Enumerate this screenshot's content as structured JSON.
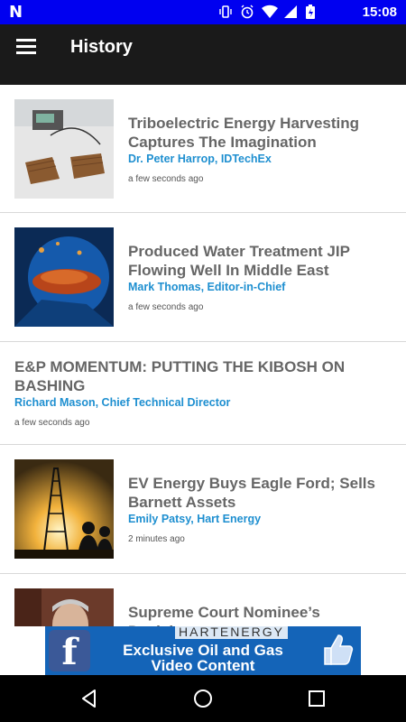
{
  "status_bar": {
    "time": "15:08",
    "left_icon": "N"
  },
  "app_bar": {
    "title": "History"
  },
  "articles": [
    {
      "title": "Triboelectric Energy Harvesting Captures The Imagination",
      "author": "Dr. Peter Harrop, IDTechEx",
      "time": "a few seconds ago",
      "has_thumb": true
    },
    {
      "title": "Produced Water Treatment JIP Flowing Well In Middle East",
      "author": "Mark Thomas, Editor-in-Chief",
      "time": "a few seconds ago",
      "has_thumb": true
    },
    {
      "title": "E&P MOMENTUM: PUTTING THE KIBOSH ON BASHING",
      "author": "Richard Mason, Chief Technical Director",
      "time": "a few seconds ago",
      "has_thumb": false
    },
    {
      "title": "EV Energy Buys Eagle Ford; Sells Barnett Assets",
      "author": "Emily Patsy, Hart Energy",
      "time": "2 minutes ago",
      "has_thumb": true
    },
    {
      "title": "Supreme Court Nominee’s Decisions",
      "author": "",
      "time": "",
      "has_thumb": true
    }
  ],
  "ad": {
    "brand": "HARTENERGY",
    "text": "Exclusive Oil and Gas Video Content",
    "fb_letter": "f"
  }
}
